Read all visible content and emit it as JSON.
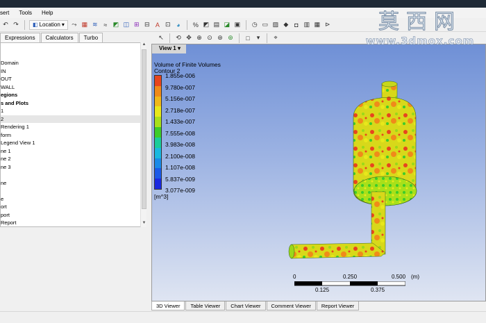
{
  "menu": [
    "sert",
    "Tools",
    "Help"
  ],
  "toolbar": {
    "location_label": "Location"
  },
  "left_tabs": [
    "Expressions",
    "Calculators",
    "Turbo"
  ],
  "tree_items": [
    {
      "label": "",
      "bold": false
    },
    {
      "label": "",
      "bold": false
    },
    {
      "label": "Domain",
      "bold": false
    },
    {
      "label": "IN",
      "bold": false
    },
    {
      "label": "OUT",
      "bold": false
    },
    {
      "label": "WALL",
      "bold": false
    },
    {
      "label": "egions",
      "bold": true
    },
    {
      "label": "s and Plots",
      "bold": true
    },
    {
      "label": "1",
      "bold": false
    },
    {
      "label": "2",
      "bold": false,
      "selected": true
    },
    {
      "label": "Rendering 1",
      "bold": false
    },
    {
      "label": "form",
      "bold": false
    },
    {
      "label": "Legend View 1",
      "bold": false
    },
    {
      "label": "ne 1",
      "bold": false
    },
    {
      "label": "ne 2",
      "bold": false
    },
    {
      "label": "ne 3",
      "bold": false
    },
    {
      "label": "",
      "bold": false
    },
    {
      "label": "ne",
      "bold": false
    },
    {
      "label": "",
      "bold": false
    },
    {
      "label": "e",
      "bold": false
    },
    {
      "label": "ort",
      "bold": false
    },
    {
      "label": "port",
      "bold": false
    },
    {
      "label": "Report",
      "bold": false
    }
  ],
  "view_label": "View 1",
  "legend": {
    "title": "Volume of Finite Volumes",
    "subtitle": "Contour 2",
    "values": [
      "1.855e-006",
      "9.780e-007",
      "5.156e-007",
      "2.718e-007",
      "1.433e-007",
      "7.555e-008",
      "3.983e-008",
      "2.100e-008",
      "1.107e-008",
      "5.837e-009",
      "3.077e-009"
    ],
    "unit": "[m^3]",
    "colors": [
      "#e8451e",
      "#f08a1a",
      "#f0b81a",
      "#e8e81a",
      "#a8e01a",
      "#3ccc2a",
      "#1acc9a",
      "#1ab8e0",
      "#1a8ae8",
      "#1a5ae8",
      "#1a2ae0"
    ]
  },
  "scale": {
    "top_labels": [
      "0",
      "0.250",
      "0.500"
    ],
    "unit": "(m)",
    "bottom_labels": [
      "0.125",
      "0.375"
    ]
  },
  "bottom_tabs": [
    "3D Viewer",
    "Table Viewer",
    "Chart Viewer",
    "Comment Viewer",
    "Report Viewer"
  ],
  "active_bottom_tab": "3D Viewer",
  "watermark": {
    "cn": "莫西网",
    "url": "www.3dmox.com"
  }
}
